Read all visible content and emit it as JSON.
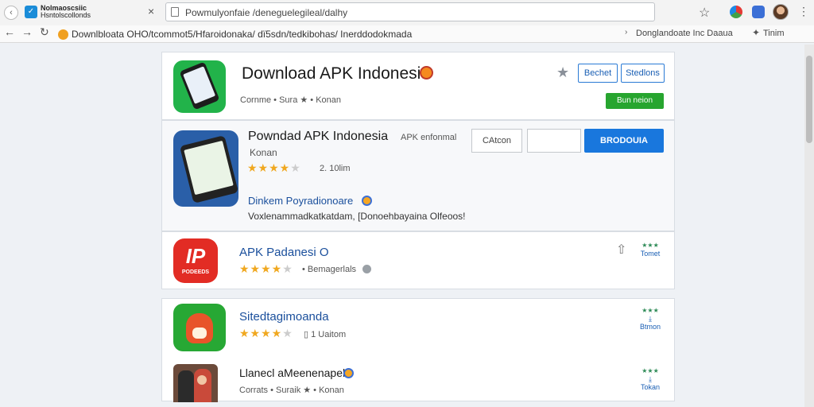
{
  "browser": {
    "tab_title": "Nolmaoscsiic",
    "tab_subtitle": "Hsntolscollonds",
    "url": "Powmulyonfaie /deneguelegileal/dalhy",
    "bookmark_path": "Downlbloata OHO/tcommot5/Hfaroidonaka/ dï5sdn/tedkibohas/ Inerddodokmada",
    "bookmark_right_1": "Donglandoate Inc Daaua",
    "bookmark_right_2": "Tinim"
  },
  "header_card": {
    "title": "Download APK Indonesia",
    "meta": "Cornme • Sura ★ • Konan",
    "button_1": "Bechet",
    "button_2": "Stedlons",
    "button_green": "Bun neion"
  },
  "featured_app": {
    "title": "Powndad APK Indonesia",
    "title_suffix": "APK enfonmal",
    "subtitle": "Konan",
    "rating_text": "2. 10lim",
    "field_1": "CAtcon",
    "field_2": "",
    "download_button": "BRODOUIA",
    "link": "Dinkem Poyradionoare",
    "description": "Voxlenammadkatkatdam, [Donoehbayaina Olfeoos!"
  },
  "apps": [
    {
      "title": "APK Padanesi O",
      "meta": "Bemagerlals",
      "side_label": "Tomet"
    },
    {
      "title": "Sitedtagimoanda",
      "meta": "1 Uaitom",
      "side_label": "Btmon"
    },
    {
      "title": "Llanecl aMeenenapela",
      "meta": "Corrats • Suraik ★ • Konan",
      "side_label": "Tokan"
    }
  ],
  "icons": {
    "app1_label": "PODEEDS"
  },
  "colors": {
    "accent_blue": "#1977dd",
    "green": "#27a52f",
    "star": "#f0a820"
  }
}
